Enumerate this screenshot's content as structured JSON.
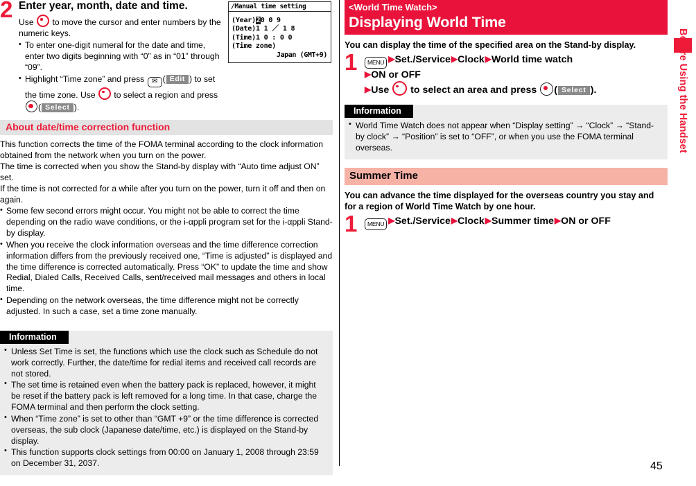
{
  "page": {
    "number": "45",
    "side_tab_label": "Before Using the Handset",
    "accent_red": "#ed1b38",
    "banner_red": "#e8123a",
    "pink_band": "#f7b2a6",
    "grey_band": "#e3e3e3",
    "info_panel_bg": "#ececec"
  },
  "left": {
    "step": {
      "number": "2",
      "title": "Enter year, month, date and time.",
      "body_prefix": "Use ",
      "body_suffix": " to move the cursor and enter numbers by the numeric keys.",
      "bullets": [
        {
          "text": "To enter one-digit numeral for the date and time, enter two digits beginning with “0” as in “01” through “09”."
        },
        {
          "prefix": "Highlight “Time zone” and press ",
          "mid": ") to set the time zone. Use ",
          "mid2": " to select a region and press ",
          "suffix": ").",
          "softkey_edit": "Edit",
          "softkey_select": "Select"
        }
      ]
    },
    "phone_screen": {
      "title": "Manual time setting",
      "year_label": "(Year)",
      "year_highlight": "2",
      "year_rest": "0 0 9",
      "date_label": "(Date)",
      "date_value": "1 1 ／ 1 8",
      "time_label": "(Time)",
      "time_value": "1 0 : 0 0",
      "tz_label": "(Time zone)",
      "tz_value": "Japan (GMT+9)"
    },
    "section": {
      "heading": "About date/time correction function",
      "paragraphs": [
        "This function corrects the time of the FOMA terminal according to the clock information obtained from the network when you turn on the power.",
        "The time is corrected when you show the Stand-by display with “Auto time adjust ON” set.",
        "If the time is not corrected for a while after you turn on the power, turn it off and then on again."
      ],
      "bullets": [
        "Some few second errors might occur. You might not be able to correct the time depending on the radio wave conditions, or the i-αppli program set for the i-αppli Stand-by display.",
        "When you receive the clock information overseas and the time difference correction information differs from the previously received one, “Time is adjusted” is displayed and the time difference is corrected automatically. Press “OK” to update the time and show Redial, Dialed Calls, Received Calls, sent/received mail messages and others in local time.",
        "Depending on the network overseas, the time difference might not be correctly adjusted. In such a case, set a time zone manually."
      ]
    },
    "information": {
      "heading": "Information",
      "bullets": [
        "Unless Set Time is set, the functions which use the clock such as Schedule do not work correctly. Further, the date/time for redial items and received call records are not stored.",
        "The set time is retained even when the battery pack is replaced, however, it might be reset if the battery pack is left removed for a long time. In that case, charge the FOMA terminal and then perform the clock setting.",
        "When “Time zone” is set to other than “GMT +9” or the time difference is corrected overseas, the sub clock (Japanese date/time, etc.) is displayed on the Stand-by display.",
        "This function supports clock settings from 00:00 on January 1, 2008 through 23:59 on December 31, 2037."
      ]
    }
  },
  "right": {
    "banner": {
      "subtitle": "<World Time Watch>",
      "title": "Displaying World Time"
    },
    "lead": "You can display the time of the specified area on the Stand-by display.",
    "operation1": {
      "number": "1",
      "menu_key": "MENU",
      "line1_items": [
        "Set./Service",
        "Clock",
        "World time watch"
      ],
      "line2_items": [
        "ON or OFF"
      ],
      "line3_prefix": "Use ",
      "line3_mid": " to select an area and press ",
      "line3_softkey": "Select",
      "line3_suffix": ")."
    },
    "information": {
      "heading": "Information",
      "bullets": [
        "World Time Watch does not appear when “Display setting” → “Clock” → “Stand-by clock” → “Position” is set to “OFF”, or when you use the FOMA terminal overseas."
      ]
    },
    "summer": {
      "heading": "Summer Time",
      "lead": "You can advance the time displayed for the overseas country you stay and for a region of World Time Watch by one hour.",
      "operation": {
        "number": "1",
        "menu_key": "MENU",
        "items": [
          "Set./Service",
          "Clock",
          "Summer time",
          "ON or OFF"
        ]
      }
    }
  }
}
